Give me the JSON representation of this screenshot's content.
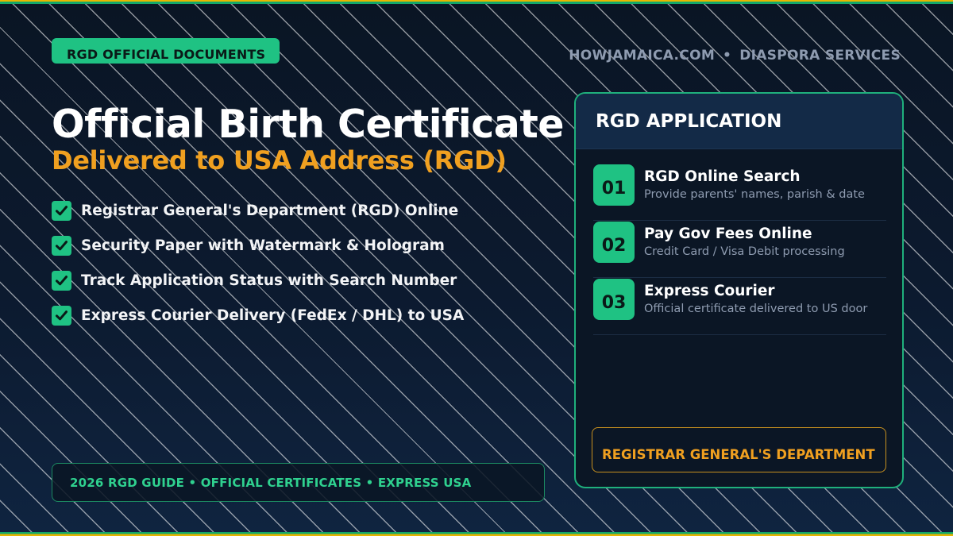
{
  "badge": {
    "label": "RGD OFFICIAL DOCUMENTS"
  },
  "site": {
    "name": "HOWJAMAICA.COM",
    "separator": "•",
    "section": "DIASPORA SERVICES"
  },
  "hero": {
    "title": "Official Birth Certificate",
    "subtitle": "Delivered to USA Address (RGD)"
  },
  "features": [
    {
      "text": "Registrar General's Department (RGD) Online"
    },
    {
      "text": "Security Paper with Watermark & Hologram"
    },
    {
      "text": "Track Application Status with Search Number"
    },
    {
      "text": "Express Courier Delivery (FedEx / DHL) to USA"
    }
  ],
  "footer": {
    "text": "2026 RGD GUIDE • OFFICIAL CERTIFICATES • EXPRESS USA"
  },
  "panel": {
    "title": "RGD APPLICATION",
    "steps": [
      {
        "num": "01",
        "title": "RGD Online Search",
        "desc": "Provide parents' names, parish & date"
      },
      {
        "num": "02",
        "title": "Pay Gov Fees Online",
        "desc": "Credit Card / Visa Debit processing"
      },
      {
        "num": "03",
        "title": "Express Courier",
        "desc": "Official certificate delivered to US door"
      }
    ],
    "footer": "REGISTRAR GENERAL'S DEPARTMENT"
  },
  "colors": {
    "background": "#0a1524",
    "accent_green": "#1fc283",
    "accent_orange": "#f0a020",
    "muted_text": "#8e9bb0"
  },
  "icons": {
    "feature_check": "check-icon"
  }
}
